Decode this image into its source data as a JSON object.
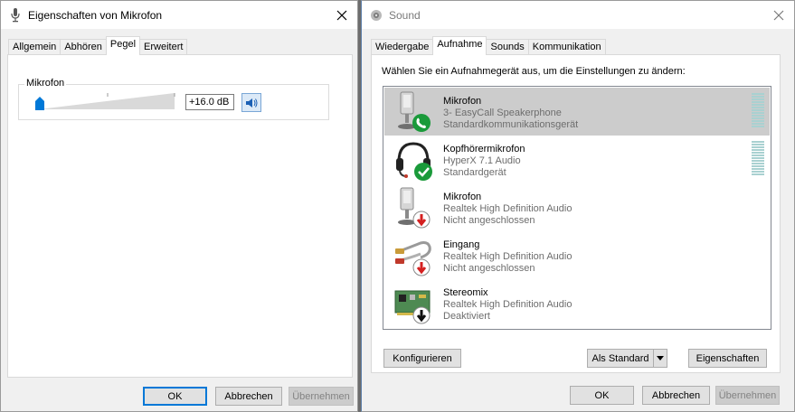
{
  "left_window": {
    "title": "Eigenschaften von Mikrofon",
    "tabs": [
      {
        "label": "Allgemein"
      },
      {
        "label": "Abhören"
      },
      {
        "label": "Pegel"
      },
      {
        "label": "Erweitert"
      }
    ],
    "active_tab": "Pegel",
    "level_group": {
      "label": "Mikrofon",
      "value": "+16.0 dB",
      "slider_level_fraction": 0.0
    },
    "buttons": {
      "ok": "OK",
      "cancel": "Abbrechen",
      "apply": "Übernehmen"
    }
  },
  "right_window": {
    "title": "Sound",
    "tabs": [
      {
        "label": "Wiedergabe"
      },
      {
        "label": "Aufnahme"
      },
      {
        "label": "Sounds"
      },
      {
        "label": "Kommunikation"
      }
    ],
    "active_tab": "Aufnahme",
    "instruction": "Wählen Sie ein Aufnahmegerät aus, um die Einstellungen zu ändern:",
    "devices": [
      {
        "name": "Mikrofon",
        "line1": "3- EasyCall Speakerphone",
        "line2": "Standardkommunikationsgerät",
        "status_icon": "phone-badge-icon",
        "selected": true
      },
      {
        "name": "Kopfhörermikrofon",
        "line1": "HyperX 7.1 Audio",
        "line2": "Standardgerät",
        "status_icon": "check-badge-icon",
        "selected": false
      },
      {
        "name": "Mikrofon",
        "line1": "Realtek High Definition Audio",
        "line2": "Nicht angeschlossen",
        "status_icon": "red-down-arrow-icon",
        "selected": false
      },
      {
        "name": "Eingang",
        "line1": "Realtek High Definition Audio",
        "line2": "Nicht angeschlossen",
        "status_icon": "red-down-arrow-icon",
        "selected": false
      },
      {
        "name": "Stereomix",
        "line1": "Realtek High Definition Audio",
        "line2": "Deaktiviert",
        "status_icon": "black-down-arrow-icon",
        "selected": false
      }
    ],
    "buttons": {
      "configure": "Konfigurieren",
      "set_default": "Als Standard",
      "properties": "Eigenschaften",
      "ok": "OK",
      "cancel": "Abbrechen",
      "apply": "Übernehmen"
    }
  },
  "colors": {
    "accent": "#0078d7",
    "selection": "#cccccc",
    "meter": "#a9d1d1",
    "badge_green": "#1a9a3a",
    "badge_red": "#d42020"
  }
}
